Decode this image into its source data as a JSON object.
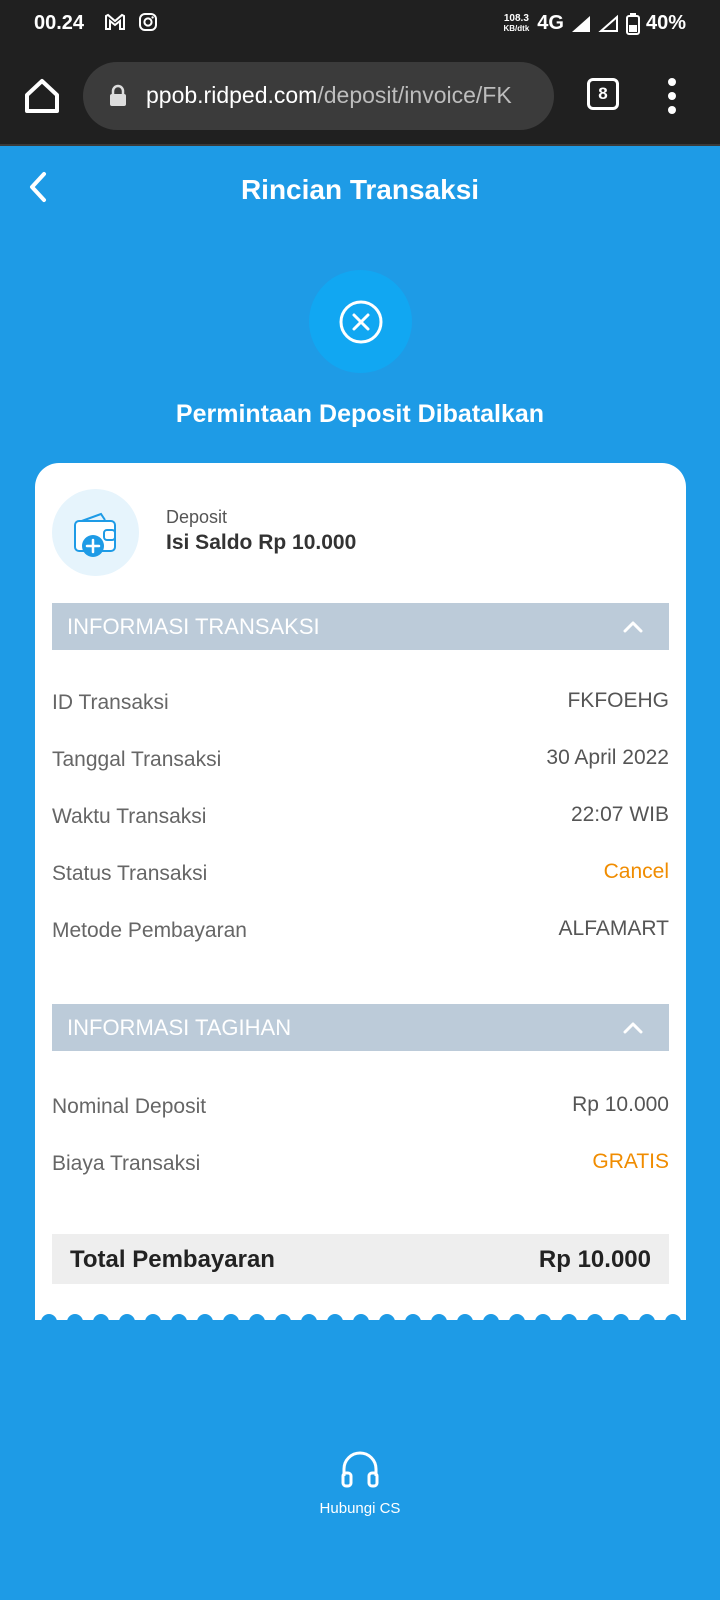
{
  "status_bar": {
    "time": "00.24",
    "speed_top": "108.3",
    "speed_bottom": "KB/dtk",
    "network": "4G",
    "battery": "40%"
  },
  "browser": {
    "url_host": "ppob.ridped.com",
    "url_path": "/deposit/invoice/FK",
    "tab_count": "8"
  },
  "header": {
    "title": "Rincian Transaksi"
  },
  "status": {
    "message": "Permintaan Deposit Dibatalkan"
  },
  "product": {
    "category": "Deposit",
    "name": "Isi Saldo Rp 10.000"
  },
  "transaction_info": {
    "title": "INFORMASI TRANSAKSI",
    "rows": [
      {
        "label": "ID Transaksi",
        "value": "FKFOEHG"
      },
      {
        "label": "Tanggal Transaksi",
        "value": "30 April 2022"
      },
      {
        "label": "Waktu Transaksi",
        "value": "22:07 WIB"
      },
      {
        "label": "Status Transaksi",
        "value": "Cancel"
      },
      {
        "label": "Metode Pembayaran",
        "value": "ALFAMART"
      }
    ]
  },
  "billing_info": {
    "title": "INFORMASI TAGIHAN",
    "rows": [
      {
        "label": "Nominal Deposit",
        "value": "Rp 10.000"
      },
      {
        "label": "Biaya Transaksi",
        "value": "GRATIS"
      }
    ]
  },
  "total": {
    "label": "Total Pembayaran",
    "value": "Rp 10.000"
  },
  "footer": {
    "cs_label": "Hubungi CS"
  },
  "colors": {
    "background": "#1e9be6",
    "accent_orange": "#f08c00",
    "section_header": "#bccbd9"
  }
}
